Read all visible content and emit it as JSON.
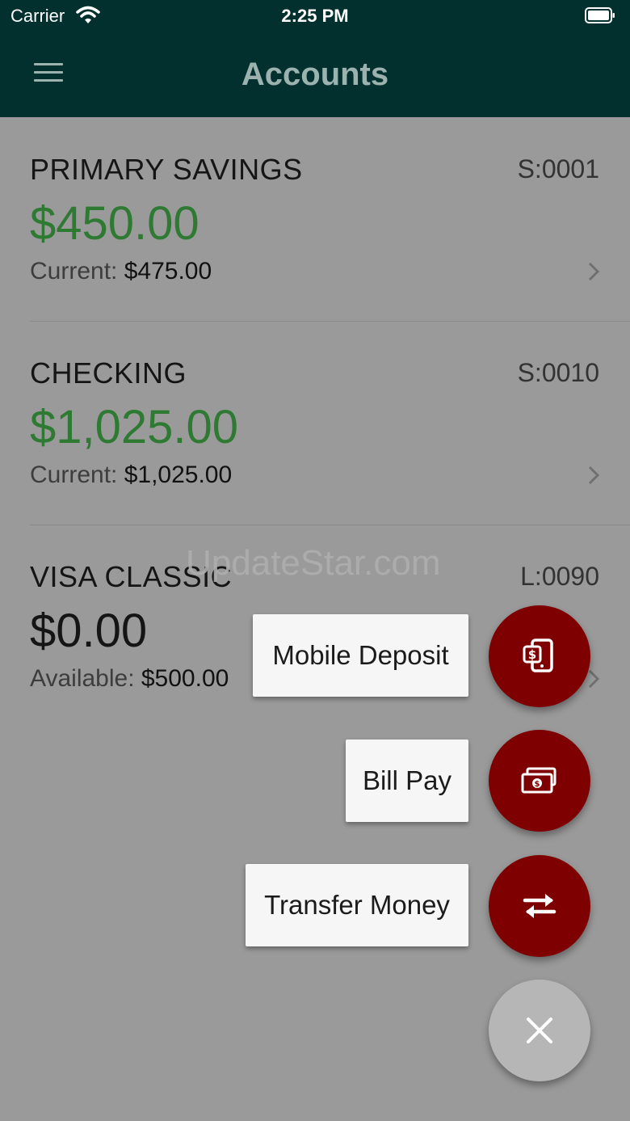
{
  "status_bar": {
    "carrier": "Carrier",
    "time": "2:25 PM"
  },
  "header": {
    "title": "Accounts"
  },
  "accounts": [
    {
      "name": "PRIMARY SAVINGS",
      "code": "S:0001",
      "amount": "$450.00",
      "sub_label": "Current: ",
      "sub_value": "$475.00"
    },
    {
      "name": "CHECKING",
      "code": "S:0010",
      "amount": "$1,025.00",
      "sub_label": "Current: ",
      "sub_value": "$1,025.00"
    },
    {
      "name": "VISA CLASSIC",
      "code": "L:0090",
      "amount": "$0.00",
      "sub_label": "Available: ",
      "sub_value": "$500.00"
    }
  ],
  "watermark": "UpdateStar.com",
  "actions": {
    "mobile_deposit": "Mobile Deposit",
    "bill_pay": "Bill Pay",
    "transfer_money": "Transfer Money"
  },
  "colors": {
    "header_bg": "#01302e",
    "positive_amount": "#2e7a32",
    "neutral_amount": "#151515",
    "fab_red": "#7e0000",
    "overlay_gray": "#9a9a9a"
  }
}
